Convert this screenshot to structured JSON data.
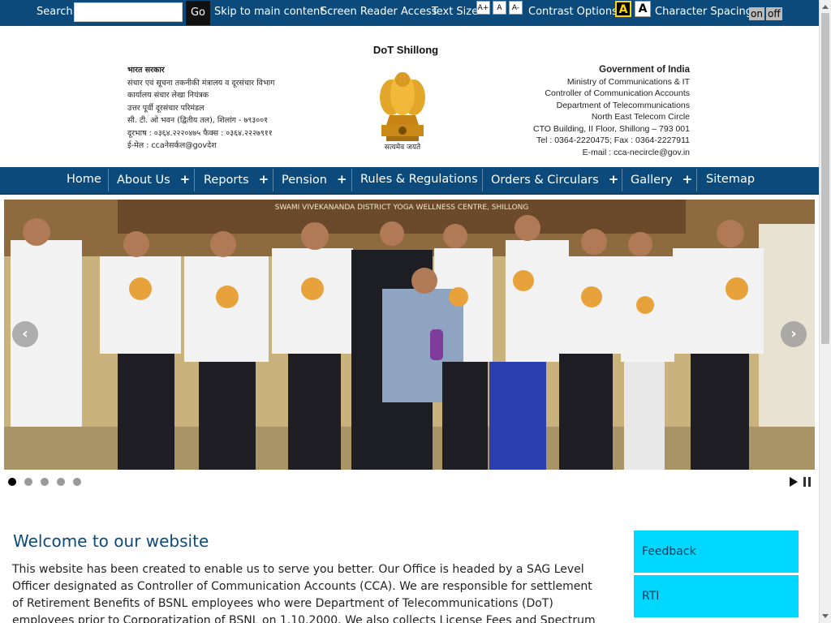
{
  "topbar": {
    "search_label": "Search",
    "search_value": "",
    "go_label": "Go",
    "skip_label": "Skip to main content",
    "screen_reader_label": "Screen Reader Access",
    "text_size_label": "Text Size",
    "text_size_buttons": [
      "A+",
      "A",
      "A-"
    ],
    "contrast_label": "Contrast Options",
    "contrast_buttons": [
      "A",
      "A"
    ],
    "char_spacing_label": "Character Spacing",
    "spacing_on": "on",
    "spacing_off": "off"
  },
  "header": {
    "site_name": "DoT Shillong",
    "hindi_lines": [
      "भारत सरकार",
      "संचार एवं सूचना तकनीकी मंत्रालय व दूरसंचार विभाग",
      "कार्यालय संचार लेखा नियंत्रक",
      "उत्तर पूर्वी दूरसंचार परिमंडल",
      "सी. टी. ओ भवन (द्वितीय तल), शिलांग - ७९३००१",
      "दूरभाष : ०३६४.२२२०४७५ फैक्स : ०३६४.२२२७९११",
      "ई-मेल : ccaनेसर्कल@govदेश"
    ],
    "english_lines": [
      "Government of India",
      "Ministry of Communications & IT",
      "Controller of Communication Accounts",
      "Department of Telecommunications",
      "North East Telecom Circle",
      "CTO Building, II Floor, Shillong – 793 001",
      "Tel : 0364-2220475; Fax : 0364-2227911",
      "E-mail : cca-necircle@gov.in"
    ],
    "emblem_motto": "सत्यमेव जयते"
  },
  "nav": {
    "items": [
      {
        "label": "Home",
        "has_submenu": false
      },
      {
        "label": "About Us",
        "has_submenu": true
      },
      {
        "label": "Reports",
        "has_submenu": true
      },
      {
        "label": "Pension",
        "has_submenu": true
      },
      {
        "label": "Rules & Regulations",
        "has_submenu": false
      },
      {
        "label": "Orders & Circulars",
        "has_submenu": true
      },
      {
        "label": "Gallery",
        "has_submenu": true
      },
      {
        "label": "Sitemap",
        "has_submenu": false
      }
    ],
    "plus_symbol": "+"
  },
  "slider": {
    "banner_text": "SWAMI VIVEKANANDA DISTRICT YOGA WELLNESS CENTRE, SHILLONG",
    "prev_symbol": "‹",
    "next_symbol": "›",
    "dot_count": 5,
    "active_dot": 1
  },
  "content": {
    "welcome_title": "Welcome to our website",
    "welcome_text": "This website has been created to enable us to serve you better. Our Office is headed by a SAG Level Officer designated as Controller of Communication Accounts (CCA). We are responsible for settlement of Retirement Benefits of BSNL employees who were Department of Telecommunications (DoT) employees prior to Corporatization of BSNL on 1.10.2000. We also collects License Fees and Spectrum"
  },
  "sidebar": {
    "buttons": [
      "Feedback",
      "RTI"
    ]
  },
  "colors": {
    "navy": "#0b4a7a",
    "cyan": "#00d7ff"
  }
}
